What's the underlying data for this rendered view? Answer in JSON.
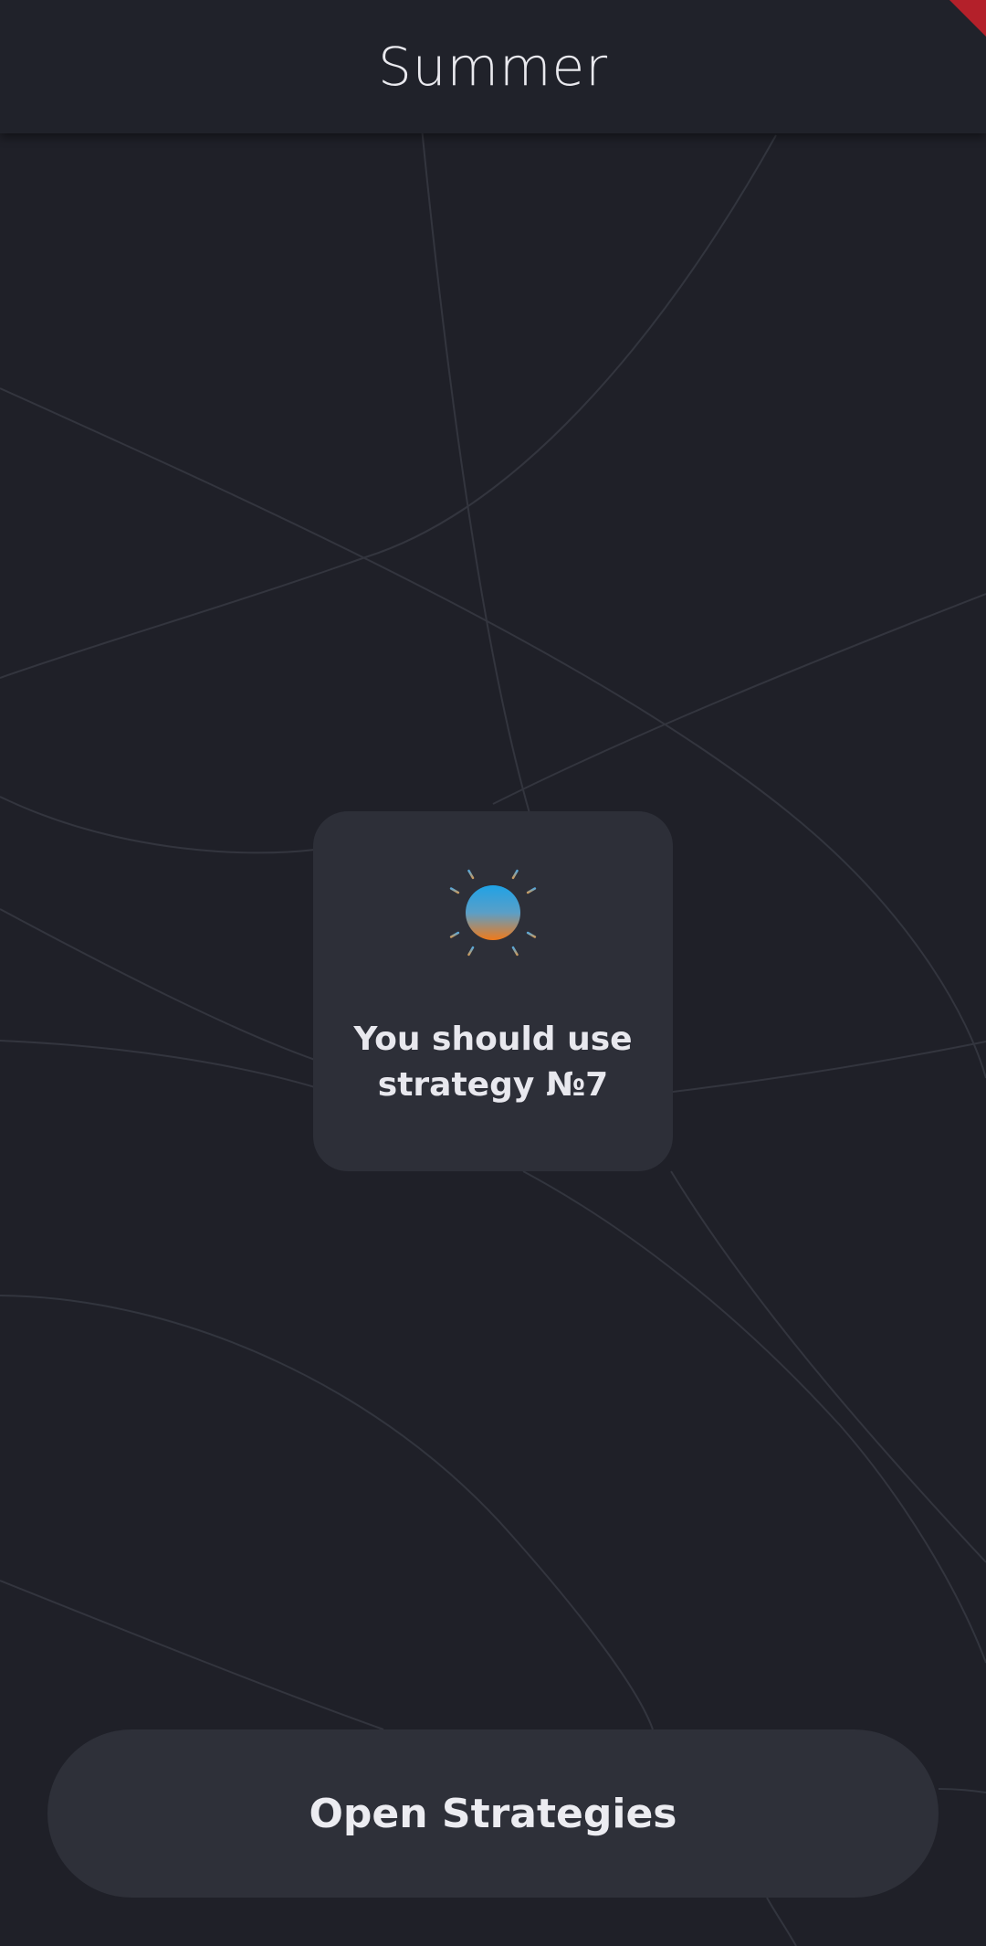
{
  "app_bar": {
    "title": "Summer"
  },
  "card": {
    "icon": "sun-icon",
    "message": "You should use\nstrategy №7"
  },
  "actions": {
    "open_strategies_label": "Open Strategies"
  },
  "colors": {
    "background": "#1f2028",
    "app_bar": "#20222a",
    "card": "#2d2f38",
    "button": "#2e3039",
    "text": "#e8e8ee",
    "sun_top": "#1fa2e6",
    "sun_bottom": "#f07a1a",
    "debug_banner": "#b4202a"
  }
}
